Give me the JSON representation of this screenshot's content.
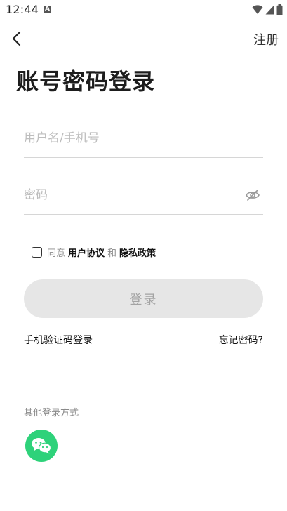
{
  "status_bar": {
    "time": "12:44",
    "notification_badge": "A",
    "icons": [
      "wifi-icon",
      "signal-icon",
      "battery-icon"
    ]
  },
  "header": {
    "back_icon": "chevron-left-icon",
    "register_label": "注册"
  },
  "page": {
    "title": "账号密码登录"
  },
  "form": {
    "username_placeholder": "用户名/手机号",
    "username_value": "",
    "password_placeholder": "密码",
    "password_value": "",
    "password_toggle_icon": "eye-hidden-icon"
  },
  "agreement": {
    "checked": false,
    "prefix": "同意",
    "user_agreement": "用户协议",
    "conjunction": "和",
    "privacy_policy": "隐私政策"
  },
  "actions": {
    "login_label": "登录",
    "sms_login_label": "手机验证码登录",
    "forgot_password_label": "忘记密码?"
  },
  "other_login": {
    "label": "其他登录方式",
    "methods": [
      "wechat-icon"
    ]
  },
  "colors": {
    "wechat": "#2ed27a",
    "button_disabled_bg": "#e6e6e6",
    "button_disabled_text": "#a3a3a3",
    "placeholder": "#bdbdbd"
  }
}
